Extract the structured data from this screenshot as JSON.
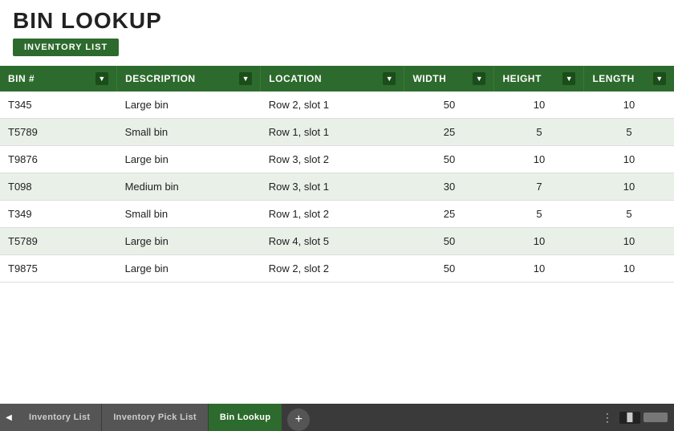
{
  "header": {
    "title": "BIN LOOKUP",
    "inventory_list_btn": "INVENTORY LIST"
  },
  "table": {
    "columns": [
      {
        "key": "bin",
        "label": "BIN #",
        "class": "col-bin"
      },
      {
        "key": "description",
        "label": "DESCRIPTION",
        "class": "col-desc"
      },
      {
        "key": "location",
        "label": "LOCATION",
        "class": "col-loc"
      },
      {
        "key": "width",
        "label": "WIDTH",
        "class": "col-width num"
      },
      {
        "key": "height",
        "label": "HEIGHT",
        "class": "col-height num"
      },
      {
        "key": "length",
        "label": "LENGTH",
        "class": "col-length num"
      }
    ],
    "rows": [
      {
        "bin": "T345",
        "description": "Large bin",
        "location": "Row 2, slot 1",
        "width": "50",
        "height": "10",
        "length": "10"
      },
      {
        "bin": "T5789",
        "description": "Small bin",
        "location": "Row 1, slot 1",
        "width": "25",
        "height": "5",
        "length": "5"
      },
      {
        "bin": "T9876",
        "description": "Large bin",
        "location": "Row 3, slot 2",
        "width": "50",
        "height": "10",
        "length": "10"
      },
      {
        "bin": "T098",
        "description": "Medium bin",
        "location": "Row 3, slot 1",
        "width": "30",
        "height": "7",
        "length": "10"
      },
      {
        "bin": "T349",
        "description": "Small bin",
        "location": "Row 1, slot 2",
        "width": "25",
        "height": "5",
        "length": "5"
      },
      {
        "bin": "T5789",
        "description": "Large bin",
        "location": "Row 4, slot 5",
        "width": "50",
        "height": "10",
        "length": "10"
      },
      {
        "bin": "T9875",
        "description": "Large bin",
        "location": "Row 2, slot 2",
        "width": "50",
        "height": "10",
        "length": "10"
      }
    ]
  },
  "tabs": [
    {
      "label": "Inventory List",
      "active": false
    },
    {
      "label": "Inventory Pick List",
      "active": false
    },
    {
      "label": "Bin Lookup",
      "active": true
    }
  ],
  "bottom_bar": {
    "arrow_left": "◀",
    "add_tab": "+",
    "dots": "⋮",
    "zoom": "▐▌"
  }
}
